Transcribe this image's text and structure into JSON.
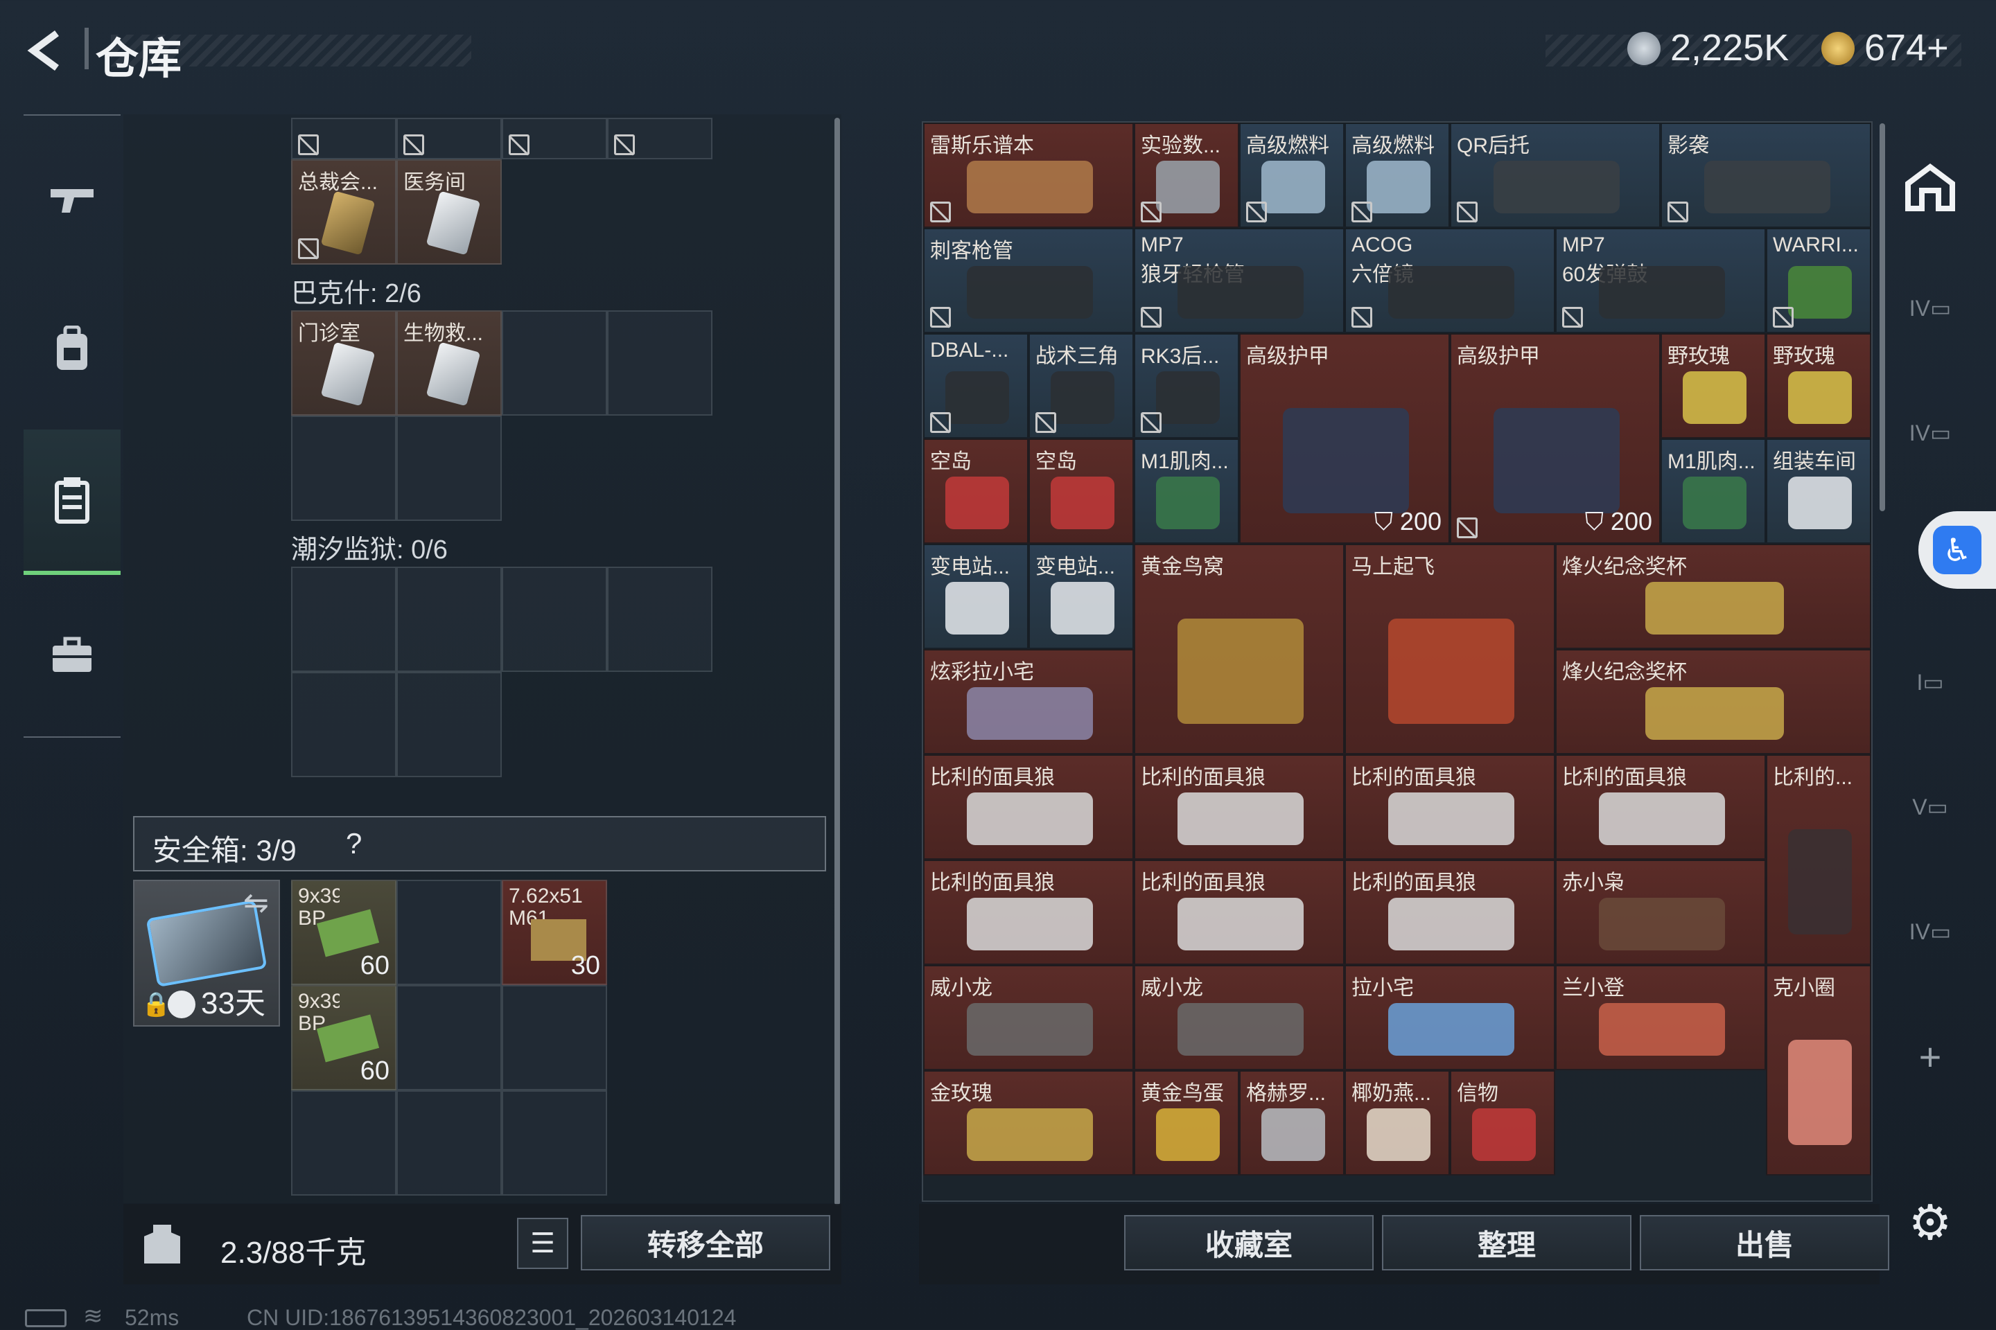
{
  "header": {
    "title": "仓库",
    "currency1": "2,225K",
    "currency2": "674+"
  },
  "left_groups": {
    "top_items": [
      {
        "label": "总裁会..."
      },
      {
        "label": "医务间"
      }
    ],
    "group1": {
      "label": "巴克什: 2/6",
      "items": [
        {
          "label": "门诊室"
        },
        {
          "label": "生物救..."
        }
      ]
    },
    "group2": {
      "label": "潮汐监狱: 0/6"
    }
  },
  "safe_box": {
    "label": "安全箱: 3/9",
    "help": "?",
    "days": "33天",
    "items": [
      {
        "label": "9x39 BP",
        "count": "60"
      },
      {
        "label": "7.62x51 M61",
        "count": "30"
      },
      {
        "label": "9x39 BP",
        "count": "60"
      }
    ]
  },
  "footer_left": {
    "weight": "2.3/88千克",
    "transfer_all": "转移全部"
  },
  "warehouse": {
    "items": [
      {
        "label": "雷斯乐谱本",
        "color": "red"
      },
      {
        "label": "实验数...",
        "color": "red"
      },
      {
        "label": "高级燃料",
        "color": "blue"
      },
      {
        "label": "高级燃料",
        "color": "blue"
      },
      {
        "label": "QR后托",
        "color": "blue"
      },
      {
        "label": "影袭",
        "color": "blue"
      },
      {
        "label": "刺客枪管",
        "color": "blue"
      },
      {
        "label": "MP7",
        "label2": "狼牙轻枪管",
        "color": "blue"
      },
      {
        "label": "ACOG",
        "label2": "六倍镜",
        "color": "blue"
      },
      {
        "label": "MP7",
        "label2": "60发弹鼓",
        "color": "blue"
      },
      {
        "label": "WARRI...",
        "color": "blue"
      },
      {
        "label": "DBAL-...",
        "color": "blue"
      },
      {
        "label": "战术三角",
        "color": "blue"
      },
      {
        "label": "RK3后...",
        "color": "blue"
      },
      {
        "label": "高级护甲",
        "color": "red",
        "durability": "200"
      },
      {
        "label": "高级护甲",
        "color": "red",
        "durability": "200"
      },
      {
        "label": "野玫瑰",
        "color": "red"
      },
      {
        "label": "野玫瑰",
        "color": "red"
      },
      {
        "label": "空岛",
        "color": "red"
      },
      {
        "label": "空岛",
        "color": "red"
      },
      {
        "label": "M1肌肉...",
        "color": "blue"
      },
      {
        "label": "M1肌肉...",
        "color": "blue"
      },
      {
        "label": "组装车间",
        "color": "blue"
      },
      {
        "label": "变电站...",
        "color": "blue"
      },
      {
        "label": "变电站...",
        "color": "blue"
      },
      {
        "label": "黄金鸟窝",
        "color": "red"
      },
      {
        "label": "马上起飞",
        "color": "red"
      },
      {
        "label": "烽火纪念奖杯",
        "color": "red"
      },
      {
        "label": "炫彩拉小宅",
        "color": "red"
      },
      {
        "label": "烽火纪念奖杯",
        "color": "red"
      },
      {
        "label": "比利的面具狼",
        "color": "red"
      },
      {
        "label": "比利的面具狼",
        "color": "red"
      },
      {
        "label": "比利的面具狼",
        "color": "red"
      },
      {
        "label": "比利的面具狼",
        "color": "red"
      },
      {
        "label": "比利的...",
        "color": "red"
      },
      {
        "label": "比利的面具狼",
        "color": "red"
      },
      {
        "label": "比利的面具狼",
        "color": "red"
      },
      {
        "label": "比利的面具狼",
        "color": "red"
      },
      {
        "label": "赤小枭",
        "color": "red"
      },
      {
        "label": "威小龙",
        "color": "red"
      },
      {
        "label": "威小龙",
        "color": "red"
      },
      {
        "label": "拉小宅",
        "color": "red"
      },
      {
        "label": "兰小登",
        "color": "red"
      },
      {
        "label": "克小圈",
        "color": "red"
      },
      {
        "label": "金玫瑰",
        "color": "red"
      },
      {
        "label": "黄金鸟蛋",
        "color": "red"
      },
      {
        "label": "格赫罗...",
        "color": "red"
      },
      {
        "label": "椰奶燕...",
        "color": "red"
      },
      {
        "label": "信物",
        "color": "red"
      }
    ]
  },
  "footer_right": {
    "collection": "收藏室",
    "sort": "整理",
    "sell": "出售"
  },
  "status_bar": {
    "ping": "52ms",
    "uid": "CN UID:18676139514360823001_202603140124"
  },
  "colors": {
    "accent_green": "#6fd07b",
    "item_red": "#5b2c28",
    "item_blue": "#2c3f52"
  }
}
